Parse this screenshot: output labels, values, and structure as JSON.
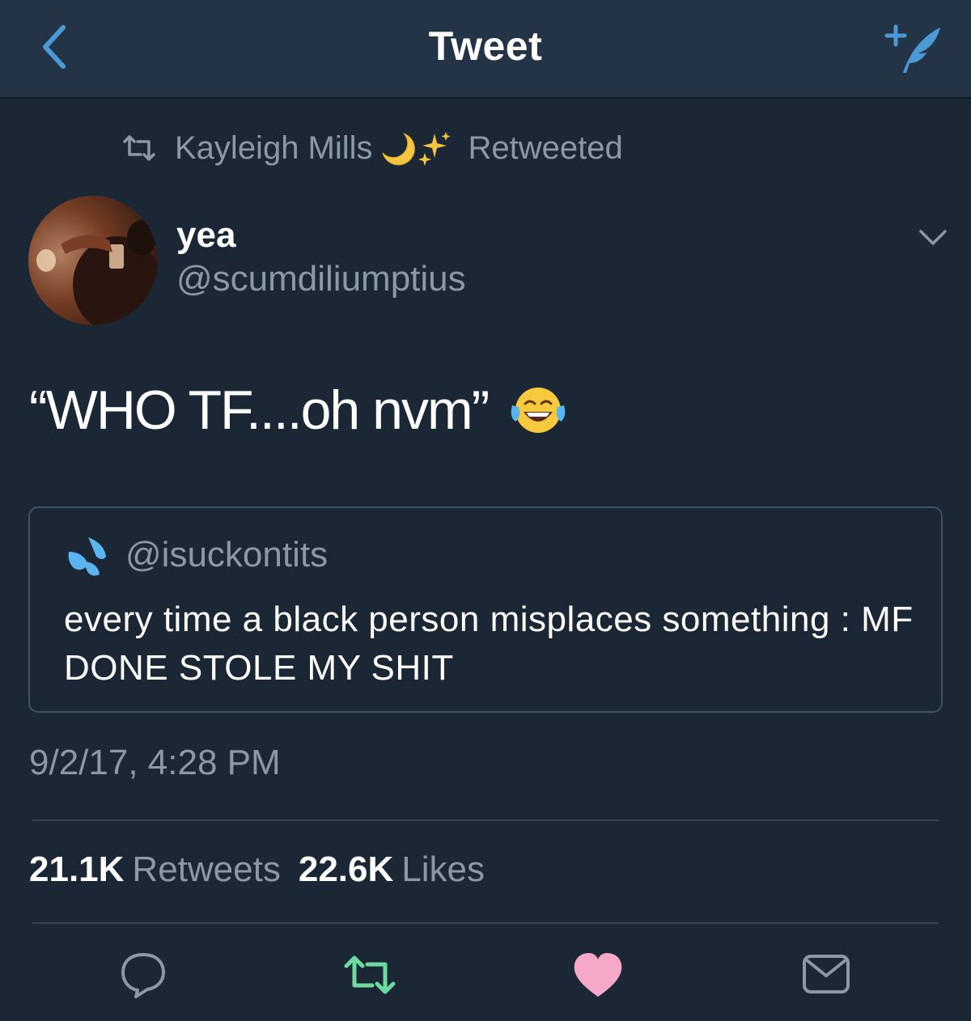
{
  "nav": {
    "title": "Tweet",
    "back_icon": "chevron-left-icon",
    "compose_icon": "compose-tweet-icon"
  },
  "retweet_context": {
    "name": "Kayleigh Mills",
    "emojis": "🌙✨",
    "suffix": "Retweeted"
  },
  "author": {
    "display_name": "yea",
    "handle": "@scumdiliumptius"
  },
  "tweet": {
    "text": "“WHO TF....oh nvm”",
    "emoji": "😂"
  },
  "quoted_tweet": {
    "emoji": "💦",
    "handle": "@isuckontits",
    "text": "every time a black person misplaces something : MF DONE STOLE MY SHIT"
  },
  "timestamp": "9/2/17, 4:28 PM",
  "stats": {
    "retweets_count": "21.1K",
    "retweets_label": "Retweets",
    "likes_count": "22.6K",
    "likes_label": "Likes"
  },
  "actions": {
    "reply_icon": "reply-icon",
    "retweet_icon": "retweet-icon",
    "like_icon": "heart-icon",
    "dm_icon": "mail-icon"
  },
  "colors": {
    "background": "#1b2734",
    "navbar": "#243447",
    "accent_blue": "#4b9ad8",
    "secondary_text": "#8b98a5",
    "retweet_green": "#6dd8a0",
    "like_pink": "#f5a8c8"
  }
}
